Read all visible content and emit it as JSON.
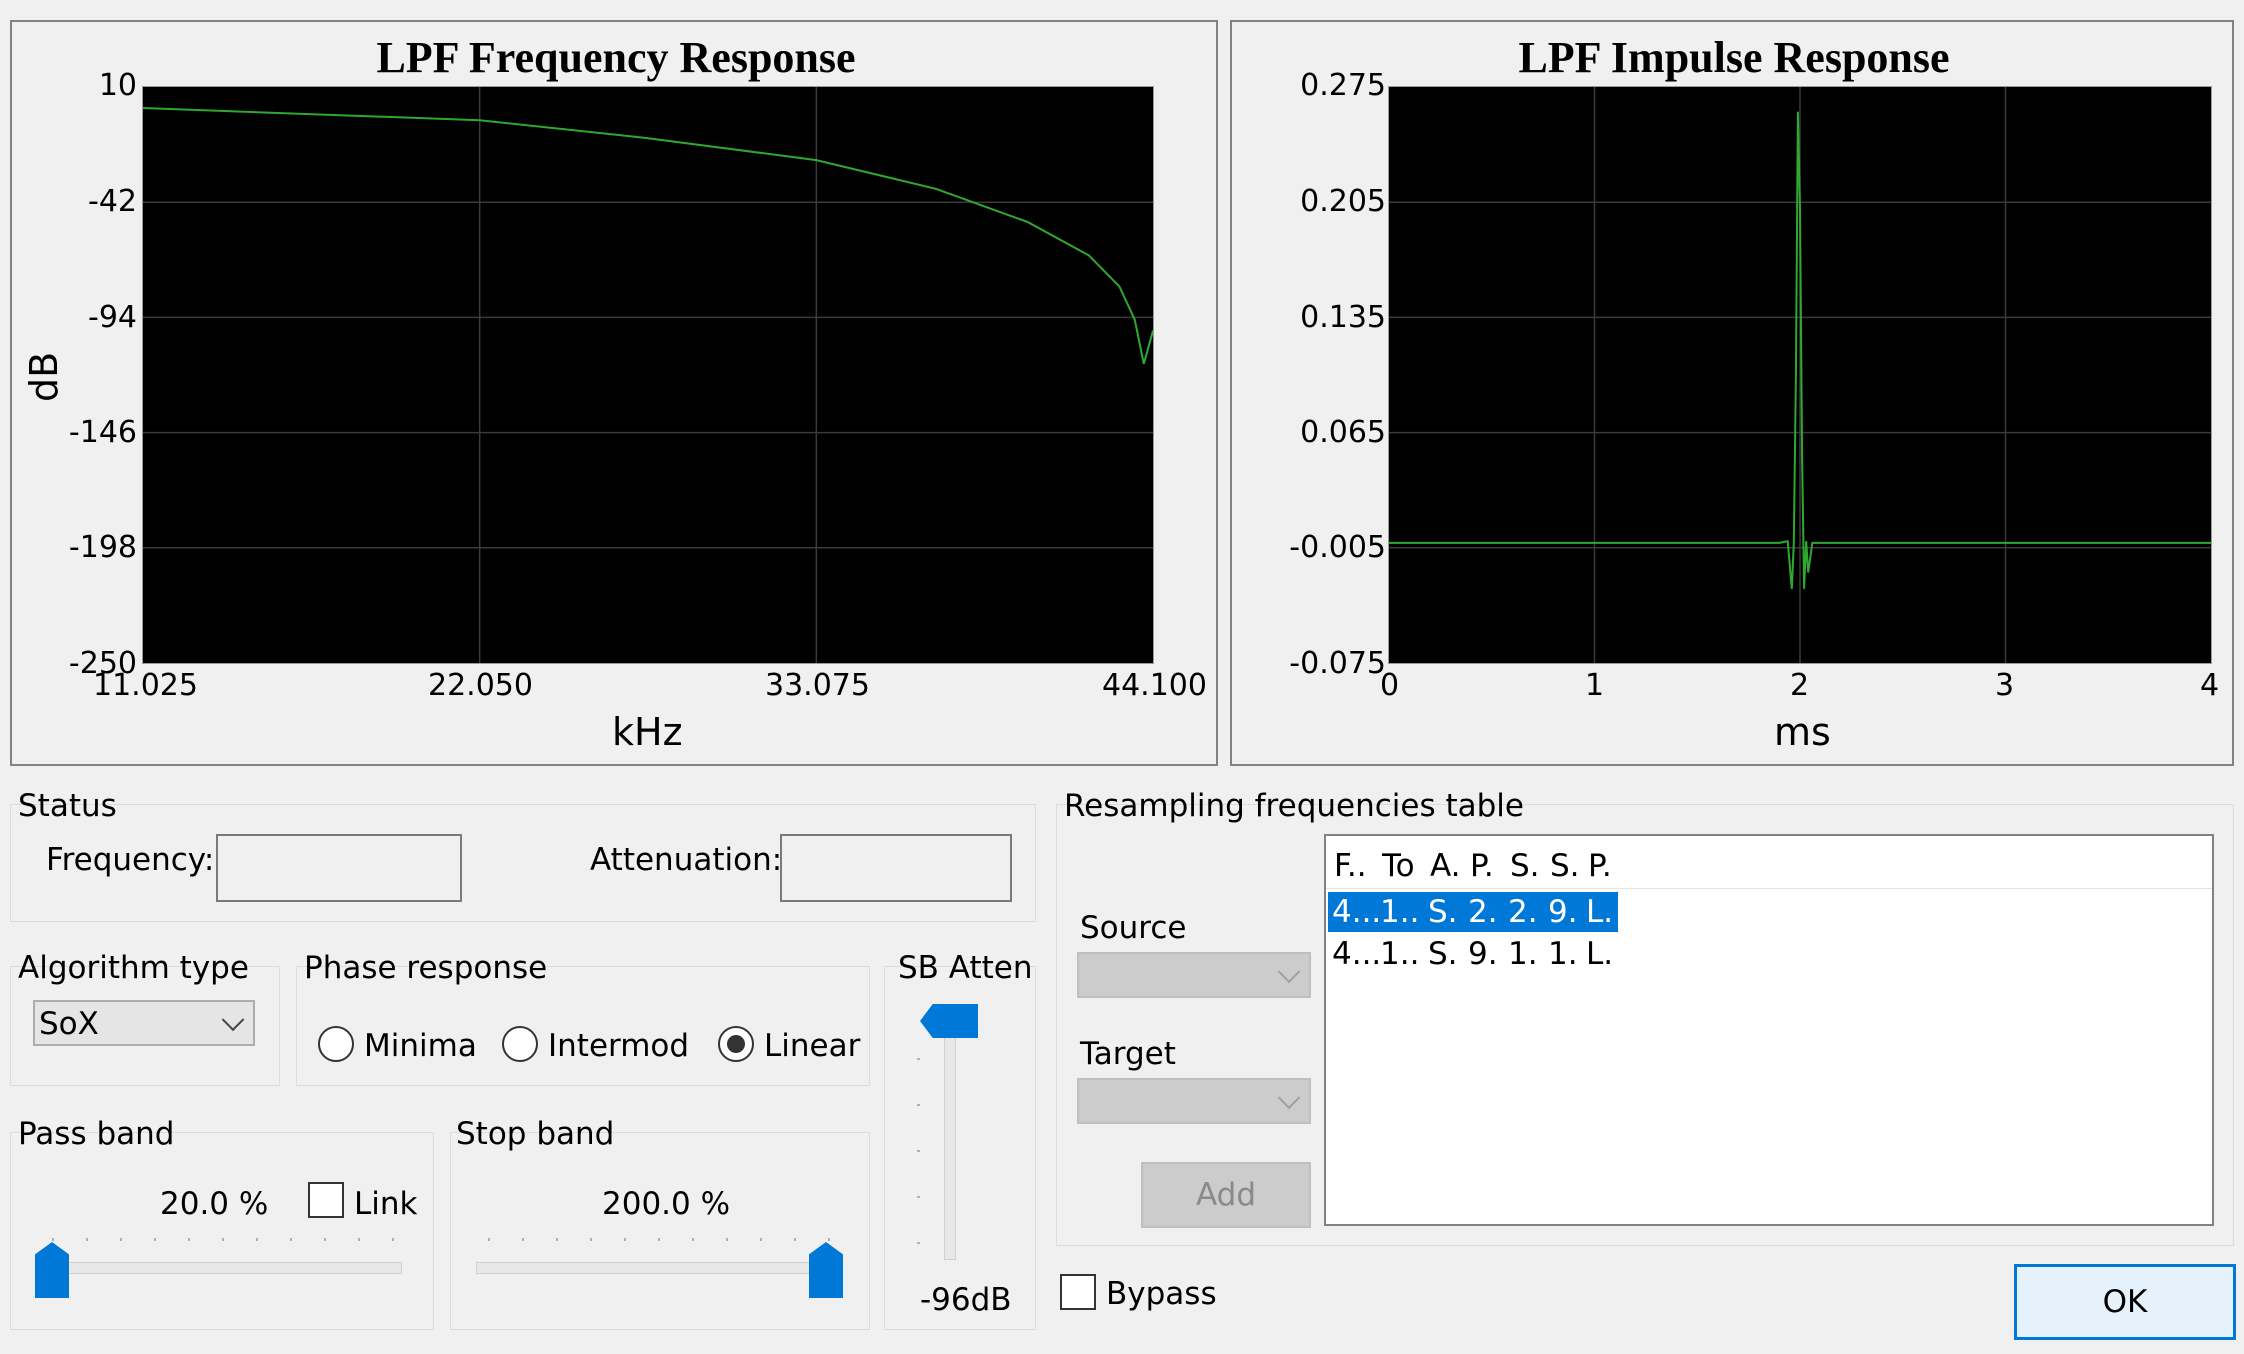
{
  "freq_chart": {
    "title": "LPF Frequency Response",
    "y_ticks": [
      "10",
      "-42",
      "-94",
      "-146",
      "-198",
      "-250"
    ],
    "x_ticks": [
      "11.025",
      "22.050",
      "33.075",
      "44.100"
    ],
    "xlabel": "kHz",
    "ylabel": "dB"
  },
  "impulse_chart": {
    "title": "LPF Impulse Response",
    "y_ticks": [
      "0.275",
      "0.205",
      "0.135",
      "0.065",
      "-0.005",
      "-0.075"
    ],
    "x_ticks": [
      "0",
      "1",
      "2",
      "3",
      "4"
    ],
    "xlabel": "ms"
  },
  "chart_data": [
    {
      "type": "line",
      "title": "LPF Frequency Response",
      "xlabel": "kHz",
      "ylabel": "dB",
      "xlim": [
        11.025,
        44.1
      ],
      "ylim": [
        -250,
        10
      ],
      "grid": true,
      "series": [
        {
          "color": "#2fa82f",
          "x": [
            11.025,
            16.0,
            22.05,
            27.5,
            33.075,
            37.0,
            40.0,
            42.0,
            43.0,
            43.5,
            43.8,
            44.0,
            44.1
          ],
          "y": [
            0.5,
            -2.0,
            -5.0,
            -13.0,
            -23.0,
            -36.0,
            -51.0,
            -66.0,
            -80.0,
            -95.0,
            -115.0,
            -105.0,
            -100.0
          ]
        }
      ]
    },
    {
      "type": "line",
      "title": "LPF Impulse Response",
      "xlabel": "ms",
      "xlim": [
        0,
        4
      ],
      "ylim": [
        -0.075,
        0.275
      ],
      "grid": true,
      "series": [
        {
          "color": "#2fa82f",
          "x": [
            0,
            1.9,
            1.94,
            1.96,
            1.97,
            1.98,
            1.99,
            2.0,
            2.01,
            2.02,
            2.03,
            2.04,
            2.06,
            2.1,
            4
          ],
          "y": [
            -0.002,
            -0.002,
            -0.001,
            -0.03,
            -0.002,
            0.1,
            0.26,
            0.2,
            0.05,
            -0.03,
            -0.001,
            -0.02,
            -0.002,
            -0.002,
            -0.002
          ]
        }
      ]
    }
  ],
  "status": {
    "group": "Status",
    "frequency_label": "Frequency:",
    "attenuation_label": "Attenuation:",
    "frequency_value": "",
    "attenuation_value": ""
  },
  "algorithm": {
    "group": "Algorithm type",
    "selected": "SoX"
  },
  "phase": {
    "group": "Phase response",
    "options": [
      "Minima",
      "Intermod",
      "Linear"
    ],
    "selected_index": 2
  },
  "sb_atten": {
    "group": "SB Atten",
    "value_label": "-96dB"
  },
  "pass_band": {
    "group": "Pass band",
    "value": "20.0 %",
    "link_label": "Link",
    "link_checked": false,
    "level_fraction": 0.0
  },
  "stop_band": {
    "group": "Stop band",
    "value": "200.0 %",
    "level_fraction": 1.0
  },
  "resampling": {
    "group": "Resampling frequencies table",
    "source_label": "Source",
    "target_label": "Target",
    "add_label": "Add",
    "columns": [
      "F..",
      "To",
      "A.",
      "P.",
      "S.",
      "S.",
      "P."
    ],
    "rows": [
      [
        "4...",
        "1..",
        "S.",
        "2.",
        "2.",
        "9.",
        "L."
      ],
      [
        "4...",
        "1..",
        "S.",
        "9.",
        "1.",
        "1.",
        "L."
      ]
    ]
  },
  "bypass": {
    "label": "Bypass",
    "checked": false
  },
  "ok_label": "OK"
}
